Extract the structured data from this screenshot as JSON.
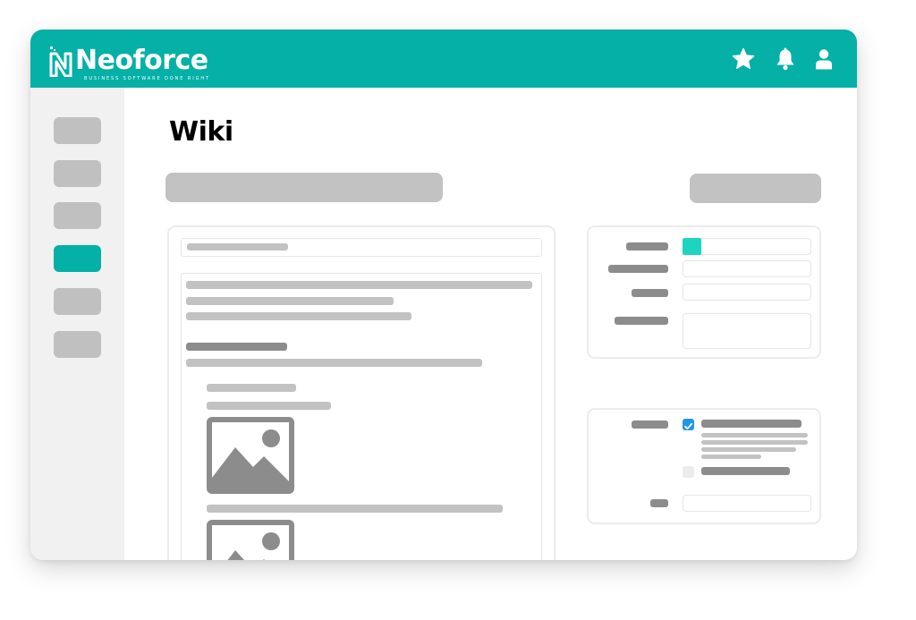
{
  "app": {
    "logo_text": "Neoforce",
    "logo_tagline": "BUSINESS SOFTWARE DONE RIGHT"
  },
  "header": {
    "icons": [
      "star-icon",
      "bell-icon",
      "user-icon"
    ]
  },
  "page": {
    "title": "Wiki"
  },
  "colors": {
    "brand": "#05b0a7",
    "active_nav": "#05b0a7",
    "swatch": "#1dd4c3",
    "checkbox": "#2196e6",
    "placeholder_light": "#c2c2c2",
    "placeholder_dark": "#8c8c8c"
  },
  "sidebar": {
    "item_count": 6,
    "active_index": 3
  },
  "properties": {
    "checkbox_states": [
      true,
      false
    ]
  }
}
